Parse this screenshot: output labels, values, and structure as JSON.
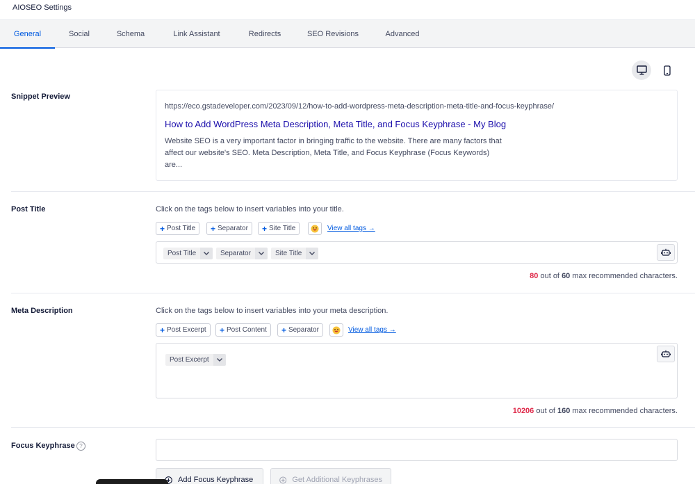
{
  "header": {
    "title": "AIOSEO Settings"
  },
  "tabs": [
    {
      "label": "General"
    },
    {
      "label": "Social"
    },
    {
      "label": "Schema"
    },
    {
      "label": "Link Assistant"
    },
    {
      "label": "Redirects"
    },
    {
      "label": "SEO Revisions"
    },
    {
      "label": "Advanced"
    }
  ],
  "active_tab": "General",
  "preview_device": "desktop",
  "snippet": {
    "label": "Snippet Preview",
    "url": "https://eco.gstadeveloper.com/2023/09/12/how-to-add-wordpress-meta-description-meta-title-and-focus-keyphrase/",
    "title": "How to Add WordPress Meta Description, Meta Title, and Focus Keyphrase - My Blog",
    "description": "Website SEO is a very important factor in bringing traffic to the website. There are many factors that affect our website's SEO. Meta Description, Meta Title, and Focus Keyphrase (Focus Keywords) are..."
  },
  "post_title": {
    "label": "Post Title",
    "hint": "Click on the tags below to insert variables into your title.",
    "tags": [
      "Post Title",
      "Separator",
      "Site Title"
    ],
    "view_all": "View all tags →",
    "chips": [
      "Post Title",
      "Separator",
      "Site Title"
    ],
    "count": "80",
    "count_mid": "out of",
    "max": "60",
    "count_suffix": "max recommended characters."
  },
  "meta_description": {
    "label": "Meta Description",
    "hint": "Click on the tags below to insert variables into your meta description.",
    "tags": [
      "Post Excerpt",
      "Post Content",
      "Separator"
    ],
    "view_all": "View all tags →",
    "chips": [
      "Post Excerpt"
    ],
    "count": "10206",
    "count_mid": "out of",
    "max": "160",
    "count_suffix": "max recommended characters."
  },
  "focus_keyphrase": {
    "label": "Focus Keyphrase",
    "help": "?",
    "input_value": "",
    "add_button": "Add Focus Keyphrase",
    "additional_button": "Get Additional Keyphrases"
  },
  "colors": {
    "accent": "#005ae0",
    "error": "#df2a4a",
    "link_title": "#1a0dab"
  }
}
